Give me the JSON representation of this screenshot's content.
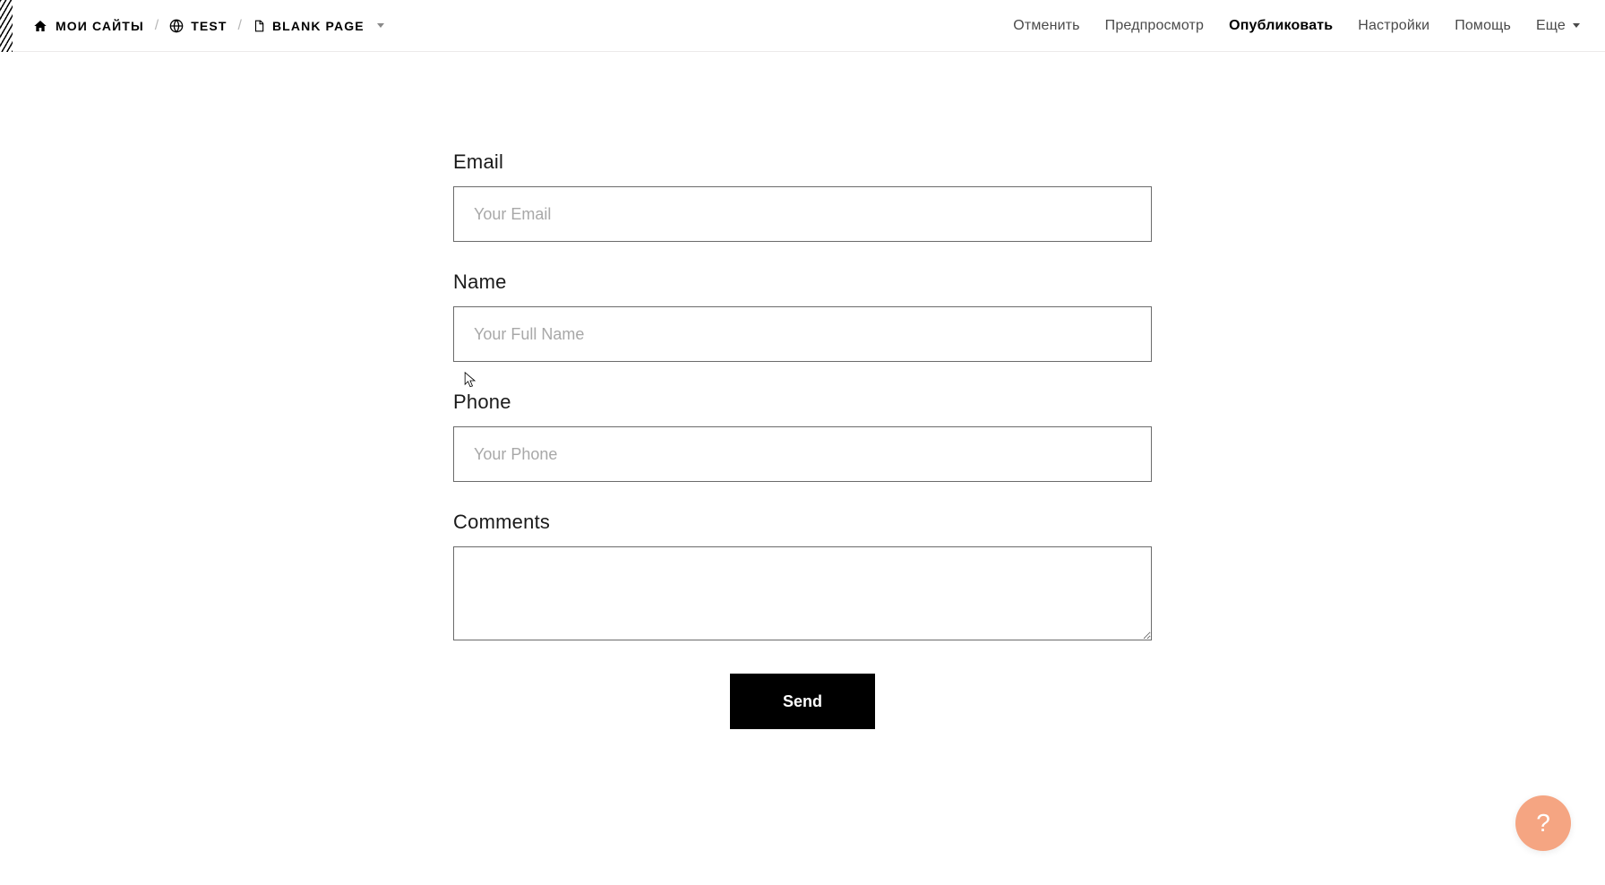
{
  "header": {
    "breadcrumb": {
      "my_sites": "МОИ САЙТЫ",
      "site_name": "TEST",
      "page_name": "BLANK PAGE"
    },
    "nav": {
      "undo": "Отменить",
      "preview": "Предпросмотр",
      "publish": "Опубликовать",
      "settings": "Настройки",
      "help": "Помощь",
      "more": "Еще"
    }
  },
  "form": {
    "email": {
      "label": "Email",
      "placeholder": "Your Email",
      "value": ""
    },
    "name": {
      "label": "Name",
      "placeholder": "Your Full Name",
      "value": ""
    },
    "phone": {
      "label": "Phone",
      "placeholder": "Your Phone",
      "value": ""
    },
    "comments": {
      "label": "Comments",
      "value": ""
    },
    "submit_label": "Send"
  },
  "help_fab": {
    "symbol": "?"
  },
  "colors": {
    "accent_fab": "#f5a582",
    "text_primary": "#000000",
    "border_input": "#6b6b6b"
  }
}
